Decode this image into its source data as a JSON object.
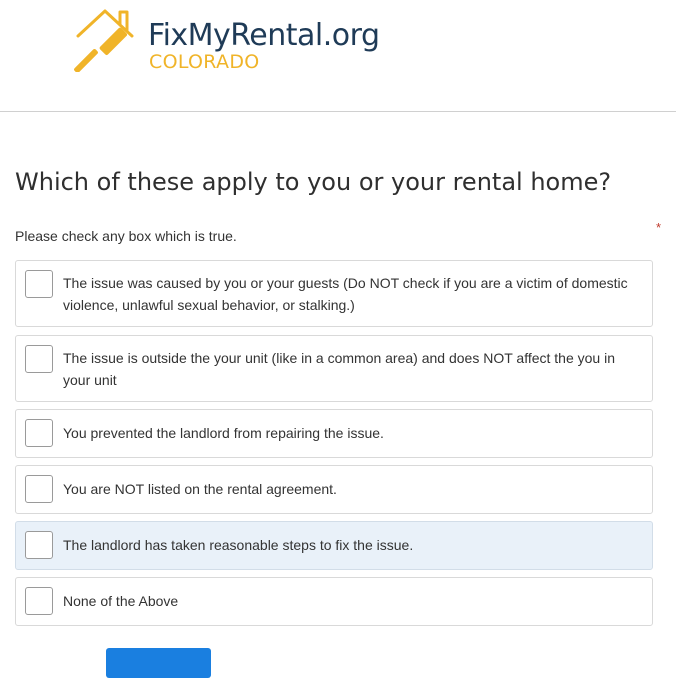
{
  "header": {
    "brand_name": "FixMyRental.org",
    "brand_sub": "COLORADO",
    "logo_icon": "house-gavel-icon",
    "colors": {
      "brand_dark": "#1f3b57",
      "brand_accent": "#f0b429"
    }
  },
  "question": {
    "title": "Which of these apply to you or your rental home?",
    "instructions": "Please check any box which is true.",
    "required_mark": "*"
  },
  "options": [
    {
      "label": "The issue was caused by you or your guests (Do NOT check if you are a victim of domestic violence, unlawful sexual behavior, or stalking.)",
      "checked": false
    },
    {
      "label": "The issue is outside the your unit (like in a common area) and does NOT affect the you in your unit",
      "checked": false
    },
    {
      "label": "You prevented the landlord from repairing the issue.",
      "checked": false
    },
    {
      "label": "You are NOT listed on the rental agreement.",
      "checked": false
    },
    {
      "label": "The landlord has taken reasonable steps to fix the issue.",
      "checked": false,
      "hovered": true
    },
    {
      "label": "None of the Above",
      "checked": false
    }
  ],
  "actions": {
    "next_label": ""
  },
  "colors": {
    "hover_bg": "#e9f1f9",
    "button": "#1a7fe0",
    "required": "#c0392b"
  }
}
